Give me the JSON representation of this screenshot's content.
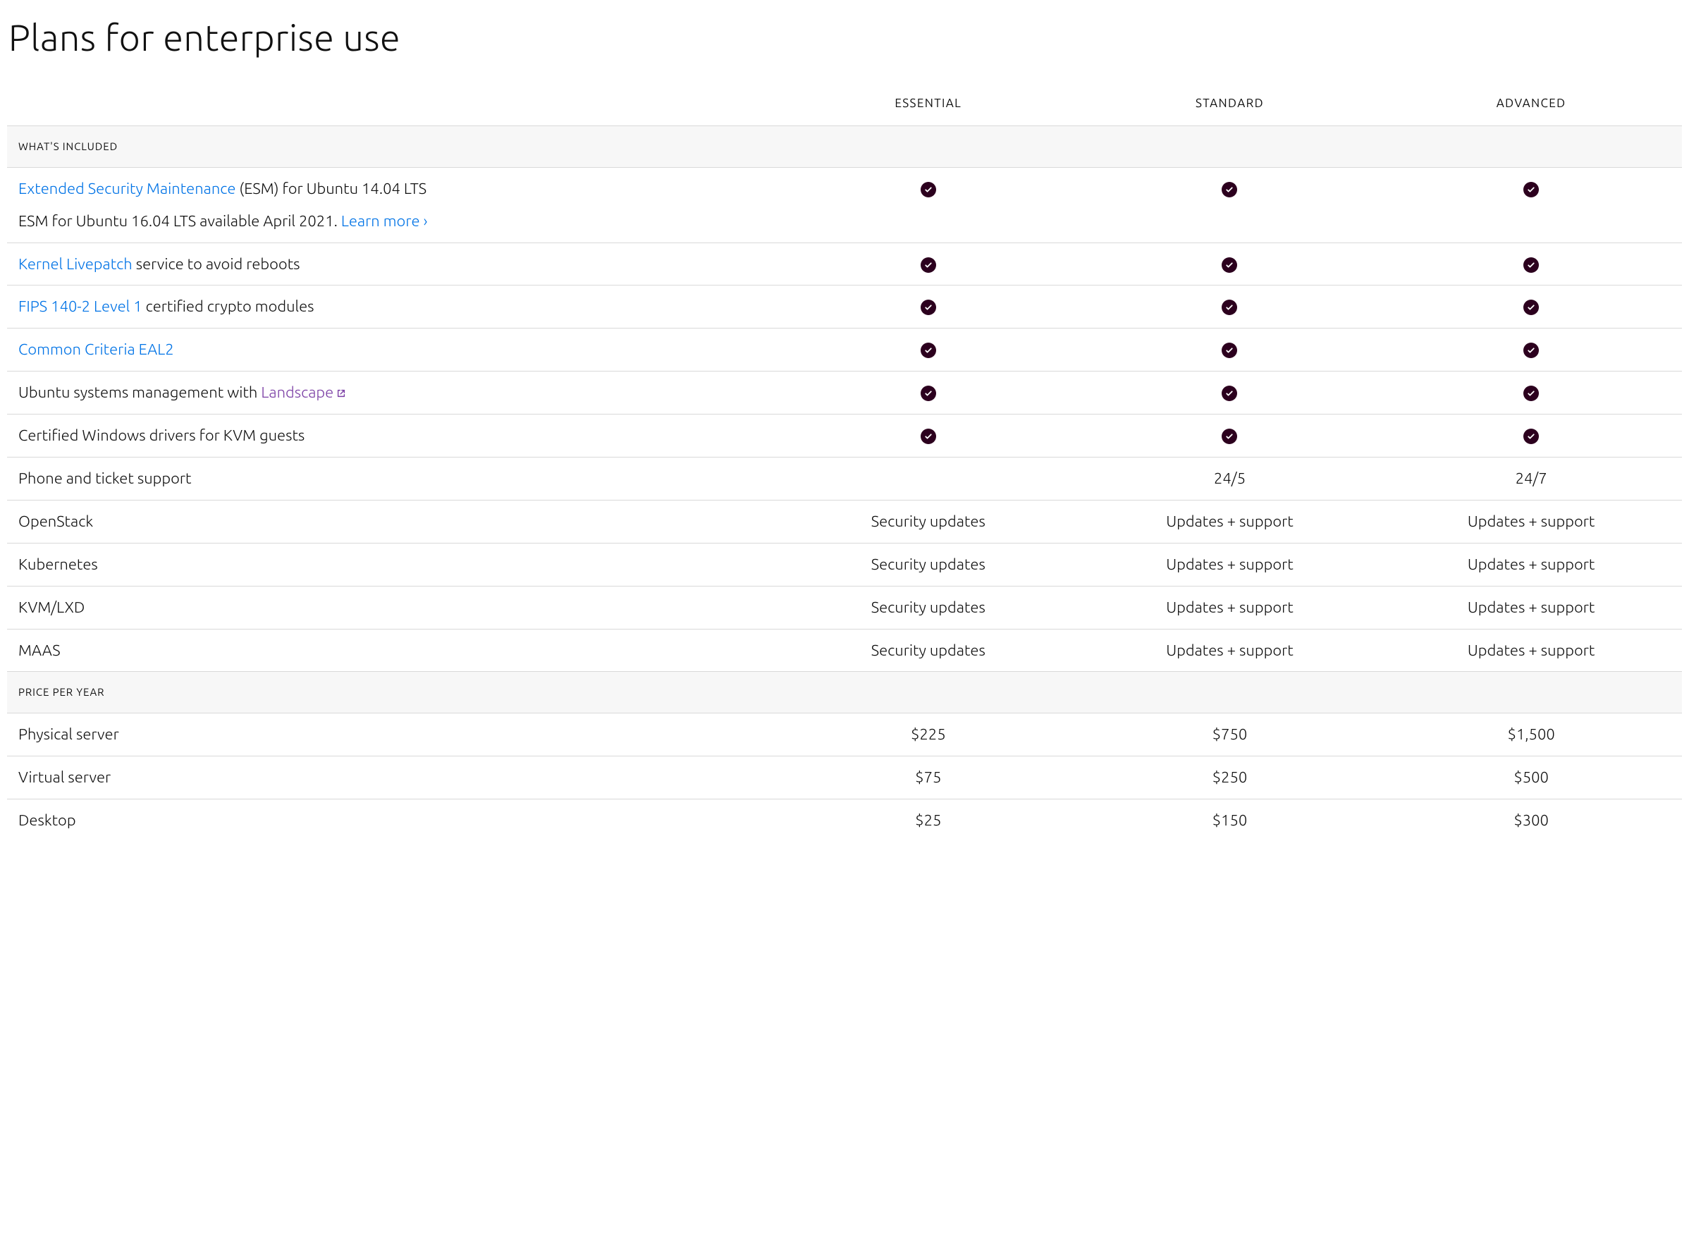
{
  "heading": "Plans for enterprise use",
  "columns": [
    "ESSENTIAL",
    "STANDARD",
    "ADVANCED"
  ],
  "sections": {
    "included": "WHAT'S INCLUDED",
    "price": "PRICE PER YEAR"
  },
  "rows": {
    "esm": {
      "link": "Extended Security Maintenance",
      "text": " (ESM) for Ubuntu 14.04 LTS",
      "sub_text": "ESM for Ubuntu 16.04 LTS available April 2021. ",
      "sub_link": "Learn more ›",
      "essential": "check",
      "standard": "check",
      "advanced": "check"
    },
    "livepatch": {
      "link": "Kernel Livepatch",
      "text": " service to avoid reboots",
      "essential": "check",
      "standard": "check",
      "advanced": "check"
    },
    "fips": {
      "link": "FIPS 140-2 Level 1",
      "text": " certified crypto modules",
      "essential": "check",
      "standard": "check",
      "advanced": "check"
    },
    "cc": {
      "link": "Common Criteria EAL2",
      "text": "",
      "essential": "check",
      "standard": "check",
      "advanced": "check"
    },
    "landscape": {
      "text_pre": "Ubuntu systems management with ",
      "link": "Landscape",
      "essential": "check",
      "standard": "check",
      "advanced": "check"
    },
    "kvm_drivers": {
      "text": "Certified Windows drivers for KVM guests",
      "essential": "check",
      "standard": "check",
      "advanced": "check"
    },
    "phone": {
      "text": "Phone and ticket support",
      "essential": "",
      "standard": "24/5",
      "advanced": "24/7"
    },
    "openstack": {
      "text": "OpenStack",
      "essential": "Security updates",
      "standard": "Updates + support",
      "advanced": "Updates + support"
    },
    "kubernetes": {
      "text": "Kubernetes",
      "essential": "Security updates",
      "standard": "Updates + support",
      "advanced": "Updates + support"
    },
    "kvmlxd": {
      "text": "KVM/LXD",
      "essential": "Security updates",
      "standard": "Updates + support",
      "advanced": "Updates + support"
    },
    "maas": {
      "text": "MAAS",
      "essential": "Security updates",
      "standard": "Updates + support",
      "advanced": "Updates + support"
    },
    "physical": {
      "text": "Physical server",
      "essential": "$225",
      "standard": "$750",
      "advanced": "$1,500"
    },
    "virtual": {
      "text": "Virtual server",
      "essential": "$75",
      "standard": "$250",
      "advanced": "$500"
    },
    "desktop": {
      "text": "Desktop",
      "essential": "$25",
      "standard": "$150",
      "advanced": "$300"
    }
  },
  "chart_data": {
    "type": "table",
    "title": "Plans for enterprise use",
    "columns": [
      "Feature",
      "Essential",
      "Standard",
      "Advanced"
    ],
    "sections": [
      {
        "name": "WHAT'S INCLUDED",
        "rows": [
          [
            "Extended Security Maintenance (ESM) for Ubuntu 14.04 LTS",
            true,
            true,
            true
          ],
          [
            "Kernel Livepatch service to avoid reboots",
            true,
            true,
            true
          ],
          [
            "FIPS 140-2 Level 1 certified crypto modules",
            true,
            true,
            true
          ],
          [
            "Common Criteria EAL2",
            true,
            true,
            true
          ],
          [
            "Ubuntu systems management with Landscape",
            true,
            true,
            true
          ],
          [
            "Certified Windows drivers for KVM guests",
            true,
            true,
            true
          ],
          [
            "Phone and ticket support",
            "",
            "24/5",
            "24/7"
          ],
          [
            "OpenStack",
            "Security updates",
            "Updates + support",
            "Updates + support"
          ],
          [
            "Kubernetes",
            "Security updates",
            "Updates + support",
            "Updates + support"
          ],
          [
            "KVM/LXD",
            "Security updates",
            "Updates + support",
            "Updates + support"
          ],
          [
            "MAAS",
            "Security updates",
            "Updates + support",
            "Updates + support"
          ]
        ]
      },
      {
        "name": "PRICE PER YEAR",
        "rows": [
          [
            "Physical server",
            "$225",
            "$750",
            "$1,500"
          ],
          [
            "Virtual server",
            "$75",
            "$250",
            "$500"
          ],
          [
            "Desktop",
            "$25",
            "$150",
            "$300"
          ]
        ]
      }
    ]
  }
}
